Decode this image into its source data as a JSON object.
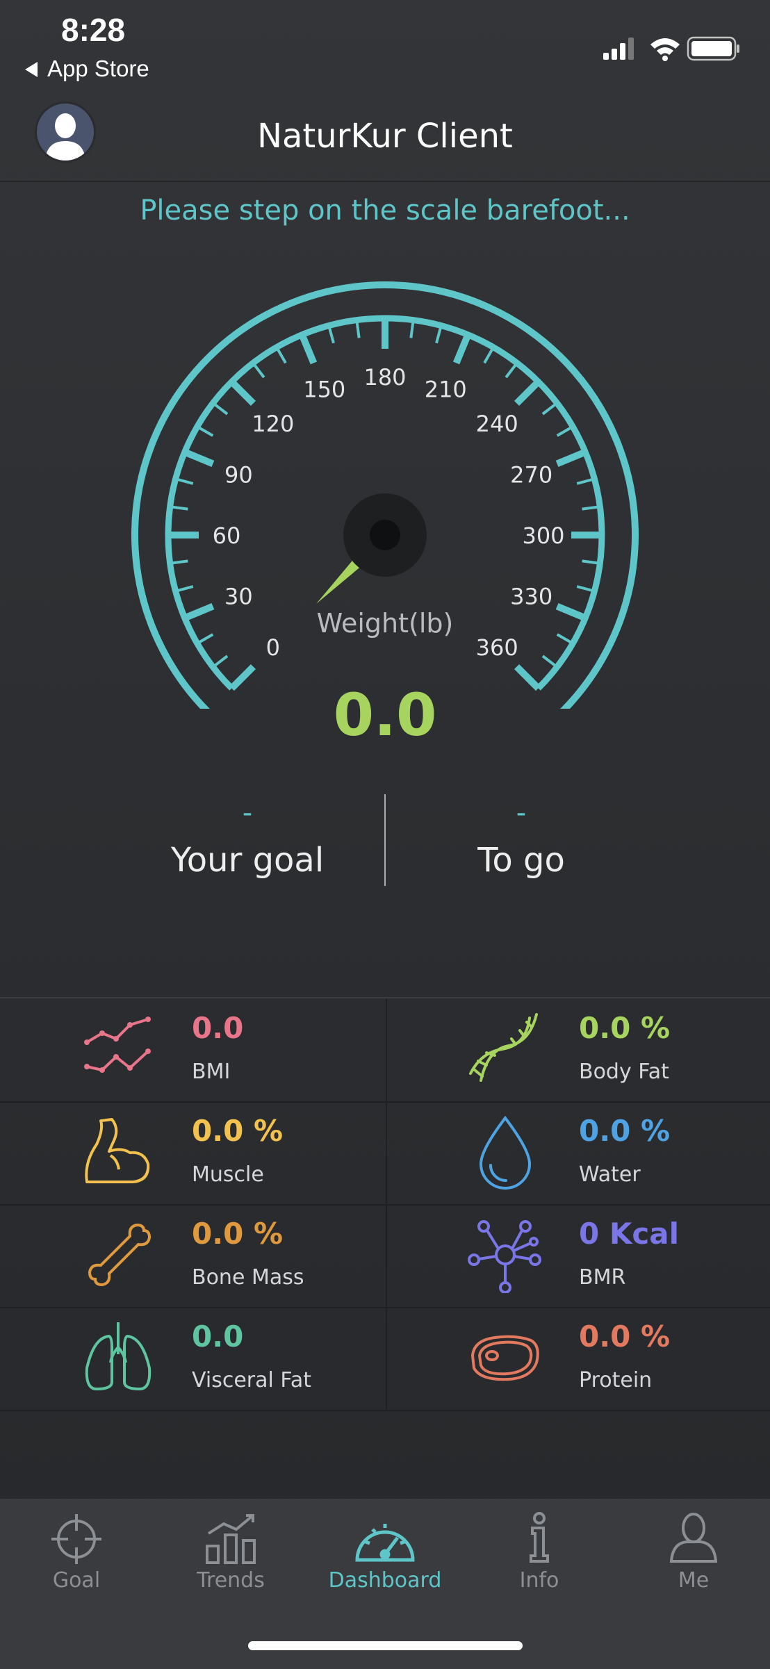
{
  "status": {
    "time": "8:28",
    "back_label": "App Store"
  },
  "header": {
    "title": "NaturKur Client"
  },
  "prompt": "Please step on the scale barefoot...",
  "gauge": {
    "min": 0,
    "max": 360,
    "ticks": [
      "0",
      "30",
      "60",
      "90",
      "120",
      "150",
      "180",
      "210",
      "240",
      "270",
      "300",
      "330",
      "360"
    ],
    "unit_label": "Weight(lb)",
    "reading": 0.0,
    "value_text": "0.0",
    "arc_color": "#5ec6c9",
    "needle_color": "#a7d35f"
  },
  "goal": {
    "goal_value": "-",
    "goal_label": "Your goal",
    "togo_value": "-",
    "togo_label": "To go"
  },
  "metrics": [
    {
      "value": "0.0",
      "label": "BMI",
      "color": "#e8758a",
      "icon": "bmi-trend-icon"
    },
    {
      "value": "0.0 %",
      "label": "Body Fat",
      "color": "#a7d35f",
      "icon": "dna-icon"
    },
    {
      "value": "0.0 %",
      "label": "Muscle",
      "color": "#f2c14e",
      "icon": "muscle-icon"
    },
    {
      "value": "0.0 %",
      "label": "Water",
      "color": "#4fa3e3",
      "icon": "water-drop-icon"
    },
    {
      "value": "0.0 %",
      "label": "Bone Mass",
      "color": "#e09a3e",
      "icon": "bone-icon"
    },
    {
      "value": "0 Kcal",
      "label": "BMR",
      "color": "#7b76e8",
      "icon": "molecule-icon"
    },
    {
      "value": "0.0",
      "label": "Visceral Fat",
      "color": "#5fc4a0",
      "icon": "lungs-icon"
    },
    {
      "value": "0.0 %",
      "label": "Protein",
      "color": "#e37a5f",
      "icon": "steak-icon"
    }
  ],
  "tabs": [
    {
      "label": "Goal",
      "icon": "crosshair-icon"
    },
    {
      "label": "Trends",
      "icon": "bar-chart-icon"
    },
    {
      "label": "Dashboard",
      "icon": "speedometer-icon",
      "active": true
    },
    {
      "label": "Info",
      "icon": "info-icon"
    },
    {
      "label": "Me",
      "icon": "person-icon"
    }
  ]
}
